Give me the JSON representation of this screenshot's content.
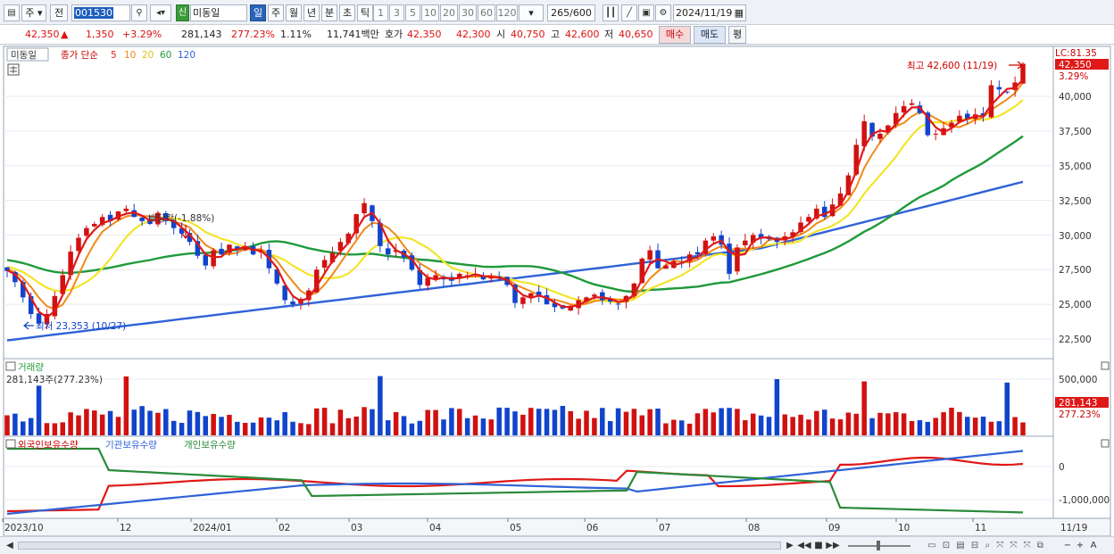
{
  "toolbar": {
    "market": "주",
    "prev": "전",
    "code": "001530",
    "name": "미동일",
    "new_badge": "신",
    "periods": [
      "일",
      "주",
      "월",
      "년",
      "분",
      "초",
      "틱"
    ],
    "intervals": [
      "1",
      "3",
      "5",
      "10",
      "20",
      "30",
      "60",
      "120"
    ],
    "count": "265",
    "count_total": "/600",
    "date": "2024/11/19"
  },
  "quote": {
    "price": "42,350",
    "arrow": "▲",
    "change": "1,350",
    "change_pct": "+3.29%",
    "volume": "281,143",
    "volume_pct": "277.23%",
    "turnover_pct": "1.11%",
    "amount": "11,741백만",
    "ask_label": "호가",
    "ask": "42,350",
    "bid": "42,300",
    "open_label": "시",
    "open": "40,750",
    "high_label": "고",
    "high": "42,600",
    "low_label": "저",
    "low": "40,650",
    "buy_btn": "매수",
    "sell_btn": "매도",
    "avg_btn": "평"
  },
  "colors": {
    "up": "#d11111",
    "down": "#1144cc",
    "ma5": "#e01818",
    "ma10": "#f08a18",
    "ma20": "#f2e52a",
    "ma60": "#1f9a3a",
    "ma120": "#2f62d8",
    "foreign": "#e01818",
    "institution": "#2f62d8",
    "individual": "#2a8a3a"
  },
  "bottom": {
    "buttons": [
      "◀",
      "▶",
      "◀◀",
      "■",
      "▶▶"
    ],
    "zoom": [
      "−",
      "+",
      "A"
    ]
  },
  "chart_data": [
    {
      "type": "candlestick",
      "title": "미동일",
      "legend": {
        "series_label": "종가 단순",
        "periods": [
          "5",
          "10",
          "20",
          "60",
          "120"
        ]
      },
      "y_ticks": [
        "40,000",
        "37,500",
        "35,000",
        "32,500",
        "30,000",
        "27,500",
        "25,000",
        "22,500"
      ],
      "ylim": [
        21600,
        43400
      ],
      "x_ticks": [
        "2023/10",
        "12",
        "2024/01",
        "02",
        "03",
        "04",
        "05",
        "06",
        "07",
        "08",
        "09",
        "10",
        "11",
        "11/19"
      ],
      "label_lc": "LC:81.35",
      "price_tag": "42,350",
      "change_tag": "3.29%",
      "annotations": {
        "high": "최고 42,600 (11/19)",
        "low": "최저 23,353 (10/27)",
        "dividend": "배당락(-1.88%)"
      },
      "closes_approx": [
        27400,
        26600,
        25500,
        24300,
        23600,
        24300,
        25600,
        27100,
        28800,
        29800,
        30500,
        30800,
        31300,
        31000,
        31700,
        31900,
        31300,
        31000,
        30800,
        31600,
        31000,
        30500,
        30100,
        29500,
        28500,
        27800,
        28900,
        28600,
        29300,
        29000,
        29200,
        28600,
        28800,
        27600,
        26500,
        25300,
        25000,
        25400,
        26000,
        27500,
        28200,
        28700,
        29500,
        30100,
        31500,
        32300,
        31000,
        29200,
        28600,
        28900,
        28400,
        27500,
        26400,
        26900,
        27100,
        26800,
        26700,
        27200,
        27100,
        27200,
        26800,
        27000,
        26900,
        26400,
        25100,
        25500,
        25800,
        25600,
        25000,
        24800,
        24700,
        24900,
        25300,
        25500,
        25700,
        25300,
        25200,
        25000,
        25600,
        26500,
        28300,
        28900,
        27600,
        27800,
        28100,
        28000,
        28600,
        28600,
        29600,
        29900,
        29300,
        27200,
        29100,
        29600,
        30000,
        29800,
        29700,
        29500,
        29900,
        30200,
        30900,
        31300,
        31900,
        31300,
        32200,
        33000,
        34300,
        36500,
        38200,
        37100,
        37300,
        37900,
        38800,
        39300,
        39500,
        38800,
        37200,
        37300,
        37700,
        38100,
        38600,
        38400,
        38700,
        38600,
        40800,
        40500,
        40300,
        41000,
        42350
      ],
      "volume_label": "거래량",
      "volume_text": "281,143주(277.23%)",
      "volume_ticks": [
        "500,000"
      ],
      "volume_tag": "281,143",
      "volume_pct_tag": "277.23%",
      "holdings_legend": [
        "외국인보유수량",
        "기관보유수량",
        "개인보유수량"
      ],
      "holdings_ticks": [
        "0",
        "-1,000,000"
      ]
    }
  ]
}
